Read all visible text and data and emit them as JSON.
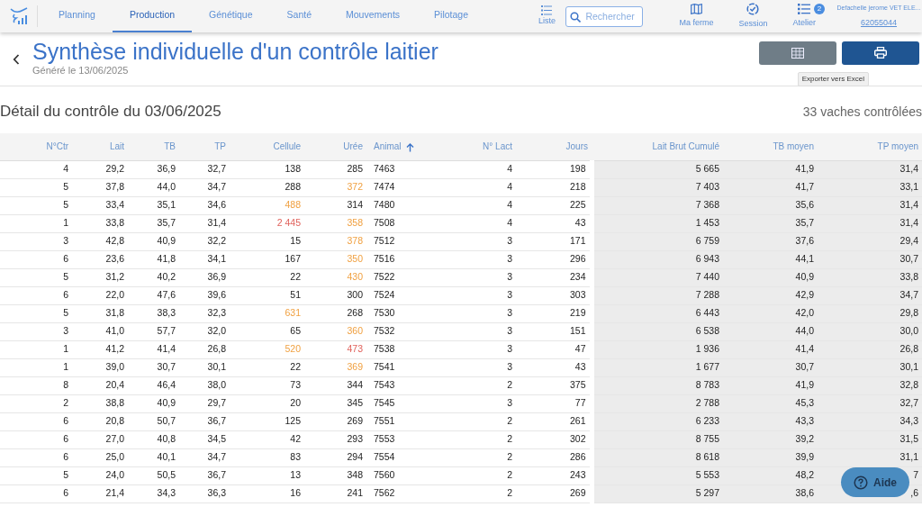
{
  "nav": {
    "tabs": [
      {
        "label": "Planning",
        "selected": false
      },
      {
        "label": "Production",
        "selected": true
      },
      {
        "label": "Génétique",
        "selected": false
      },
      {
        "label": "Santé",
        "selected": false
      },
      {
        "label": "Mouvements",
        "selected": false
      },
      {
        "label": "Pilotage",
        "selected": false
      }
    ],
    "list_label": "Liste",
    "search": {
      "placeholder": "Rechercher"
    },
    "actions": [
      {
        "kind": "map",
        "label": "Ma ferme"
      },
      {
        "kind": "session",
        "label": "Session"
      },
      {
        "kind": "atelier",
        "label": "Atelier",
        "badge": "2"
      }
    ],
    "user": {
      "name": "Defachelle jerome VET ELE...",
      "code": "62055044"
    }
  },
  "page": {
    "title": "Synthèse individuelle d'un contrôle laitier",
    "subtitle": "Généré le 13/06/2025",
    "tooltip": "Exporter vers Excel"
  },
  "section": {
    "title": "Détail du contrôle du 03/06/2025",
    "count": "33 vaches contrôlées"
  },
  "table": {
    "columns": [
      {
        "label": "N°Ctr"
      },
      {
        "label": "Lait"
      },
      {
        "label": "TB"
      },
      {
        "label": "TP"
      },
      {
        "label": "Cellule"
      },
      {
        "label": "Urée"
      },
      {
        "label": "Animal",
        "sorted": true
      },
      {
        "label": "N° Lact"
      },
      {
        "label": "Jours"
      },
      {
        "label": "Lait Brut Cumulé"
      },
      {
        "label": "TB moyen"
      },
      {
        "label": "TP moyen"
      }
    ],
    "rows": [
      [
        "4",
        "29,2",
        "36,9",
        "32,7",
        "138",
        "285",
        "7463",
        "4",
        "198",
        "5 665",
        "41,9",
        "31,4"
      ],
      [
        "5",
        "37,8",
        "44,0",
        "34,7",
        "288",
        {
          "text": "372",
          "color": "#f0a040"
        },
        "7474",
        "4",
        "218",
        "7 403",
        "41,7",
        "33,1"
      ],
      [
        "5",
        "33,4",
        "35,1",
        "34,6",
        {
          "text": "488",
          "color": "#f0a040"
        },
        "314",
        "7480",
        "4",
        "225",
        "7 368",
        "35,6",
        "31,4"
      ],
      [
        "1",
        "33,8",
        "35,7",
        "31,4",
        {
          "text": "2 445",
          "color": "#e0605a"
        },
        {
          "text": "358",
          "color": "#f0a040"
        },
        "7508",
        "4",
        "43",
        "1 453",
        "35,7",
        "31,4"
      ],
      [
        "3",
        "42,8",
        "40,9",
        "32,2",
        "15",
        {
          "text": "378",
          "color": "#f0a040"
        },
        "7512",
        "3",
        "171",
        "6 759",
        "37,6",
        "29,4"
      ],
      [
        "6",
        "23,6",
        "41,8",
        "34,1",
        "167",
        {
          "text": "350",
          "color": "#f0a040"
        },
        "7516",
        "3",
        "296",
        "6 943",
        "44,1",
        "30,7"
      ],
      [
        "5",
        "31,2",
        "40,2",
        "36,9",
        "22",
        {
          "text": "430",
          "color": "#f0a040"
        },
        "7522",
        "3",
        "234",
        "7 440",
        "40,9",
        "33,8"
      ],
      [
        "6",
        "22,0",
        "47,6",
        "39,6",
        "51",
        "300",
        "7524",
        "3",
        "303",
        "7 288",
        "42,9",
        "34,7"
      ],
      [
        "5",
        "31,8",
        "38,3",
        "32,3",
        {
          "text": "631",
          "color": "#f0a040"
        },
        "268",
        "7530",
        "3",
        "219",
        "6 443",
        "42,0",
        "29,8"
      ],
      [
        "3",
        "41,0",
        "57,7",
        "32,0",
        "65",
        {
          "text": "360",
          "color": "#f0a040"
        },
        "7532",
        "3",
        "151",
        "6 538",
        "44,0",
        "30,0"
      ],
      [
        "1",
        "41,2",
        "41,4",
        "26,8",
        {
          "text": "520",
          "color": "#f0a040"
        },
        {
          "text": "473",
          "color": "#e0605a"
        },
        "7538",
        "3",
        "47",
        "1 936",
        "41,4",
        "26,8"
      ],
      [
        "1",
        "39,0",
        "30,7",
        "30,1",
        "22",
        {
          "text": "369",
          "color": "#f0a040"
        },
        "7541",
        "3",
        "43",
        "1 677",
        "30,7",
        "30,1"
      ],
      [
        "8",
        "20,4",
        "46,4",
        "38,0",
        "73",
        "344",
        "7543",
        "2",
        "375",
        "8 783",
        "41,9",
        "32,8"
      ],
      [
        "2",
        "38,8",
        "40,9",
        "29,7",
        "20",
        "345",
        "7545",
        "3",
        "77",
        "2 788",
        "45,3",
        "32,7"
      ],
      [
        "6",
        "20,8",
        "50,7",
        "36,7",
        "125",
        "269",
        "7551",
        "2",
        "261",
        "6 233",
        "43,3",
        "34,3"
      ],
      [
        "6",
        "27,0",
        "40,8",
        "34,5",
        "42",
        "293",
        "7553",
        "2",
        "302",
        "8 755",
        "39,2",
        "31,5"
      ],
      [
        "6",
        "25,0",
        "40,1",
        "34,7",
        "83",
        "294",
        "7554",
        "2",
        "286",
        "8 618",
        "39,9",
        "31,1"
      ],
      [
        "5",
        "24,0",
        "50,5",
        "36,7",
        "13",
        "348",
        "7560",
        "2",
        "243",
        "5 553",
        "48,2",
        "7"
      ],
      [
        "6",
        "21,4",
        "34,3",
        "36,3",
        "16",
        "241",
        "7562",
        "2",
        "269",
        "5 297",
        "38,6",
        ",6"
      ]
    ]
  },
  "help": {
    "label": "Aide"
  }
}
